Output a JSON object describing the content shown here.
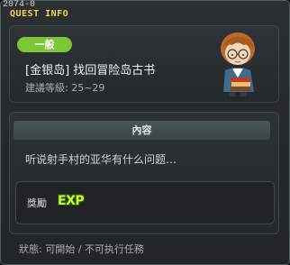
{
  "window": {
    "quest_id": "2074-0",
    "title": "QUEST INFO"
  },
  "quest": {
    "category_badge": "一般",
    "name": "[金银岛] 找回冒险岛古书",
    "level_requirement": "建議等級: 25~29",
    "npc_icon": "npc-scholar-portrait-icon"
  },
  "content": {
    "header": "內容",
    "summary": "听说射手村的亚华有什么问题…"
  },
  "reward": {
    "label": "獎勵",
    "exp_label": "EXP"
  },
  "status": {
    "text": "狀態: 可開始 / 不可执行任務"
  },
  "colors": {
    "title": "#f2d64a",
    "badge": "#7cc637",
    "exp": "#c7f43a"
  }
}
